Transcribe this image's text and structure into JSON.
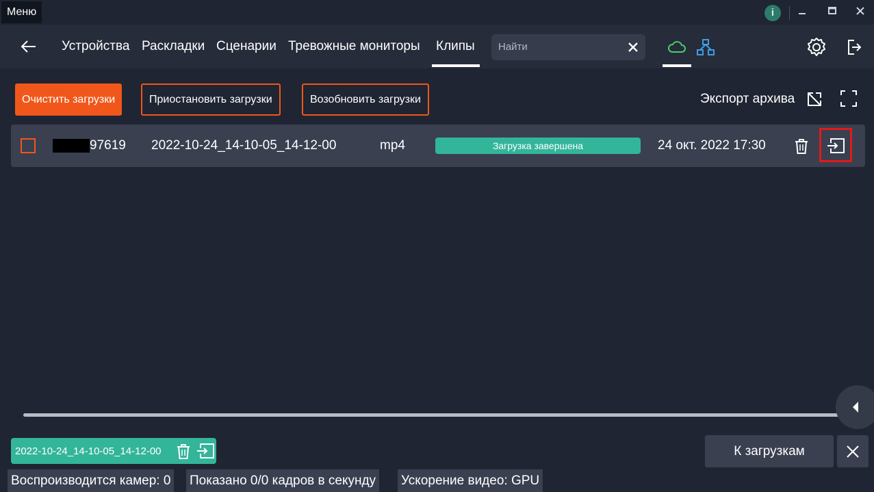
{
  "titlebar": {
    "menu_label": "Меню",
    "info_label": "i"
  },
  "nav": {
    "tabs": [
      {
        "label": "Устройства"
      },
      {
        "label": "Раскладки"
      },
      {
        "label": "Сценарии"
      },
      {
        "label": "Тревожные мониторы"
      },
      {
        "label": "Клипы",
        "active": true
      }
    ],
    "search_placeholder": "Найти"
  },
  "toolbar": {
    "clear_label": "Очистить загрузки",
    "pause_label": "Приостановить загрузки",
    "resume_label": "Возобновить загрузки",
    "export_label": "Экспорт архива"
  },
  "downloads": [
    {
      "device_suffix": "97619",
      "filename": "2022-10-24_14-10-05_14-12-00",
      "format": "mp4",
      "status": "Загрузка завершена",
      "date": "24 окт. 2022 17:30"
    }
  ],
  "clip_chip": {
    "name": "2022-10-24_14-10-05_14-12-00"
  },
  "panel": {
    "to_downloads_label": "К загрузкам"
  },
  "statusbar": {
    "cameras": "Воспроизводится камер: 0",
    "frames": "Показано 0/0 кадров в секунду",
    "acceleration": "Ускорение видео: GPU"
  },
  "colors": {
    "accent": "#f1571b",
    "success": "#33b59a",
    "background": "#1f2532",
    "highlight": "#e31a1a"
  }
}
